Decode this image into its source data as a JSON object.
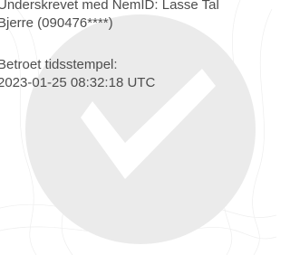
{
  "signature": {
    "line1": "Underskrevet med NemID: Lasse Tal",
    "line2": "Bjerre (090476****)"
  },
  "timestamp": {
    "label": "Betroet tidsstempel:",
    "value": "2023-01-25 08:32:18 UTC"
  },
  "watermark": {
    "icon": "checkmark-seal-icon",
    "circle_color": "#ebebeb",
    "check_color": "#ffffff",
    "line_color": "#eeeeee"
  }
}
